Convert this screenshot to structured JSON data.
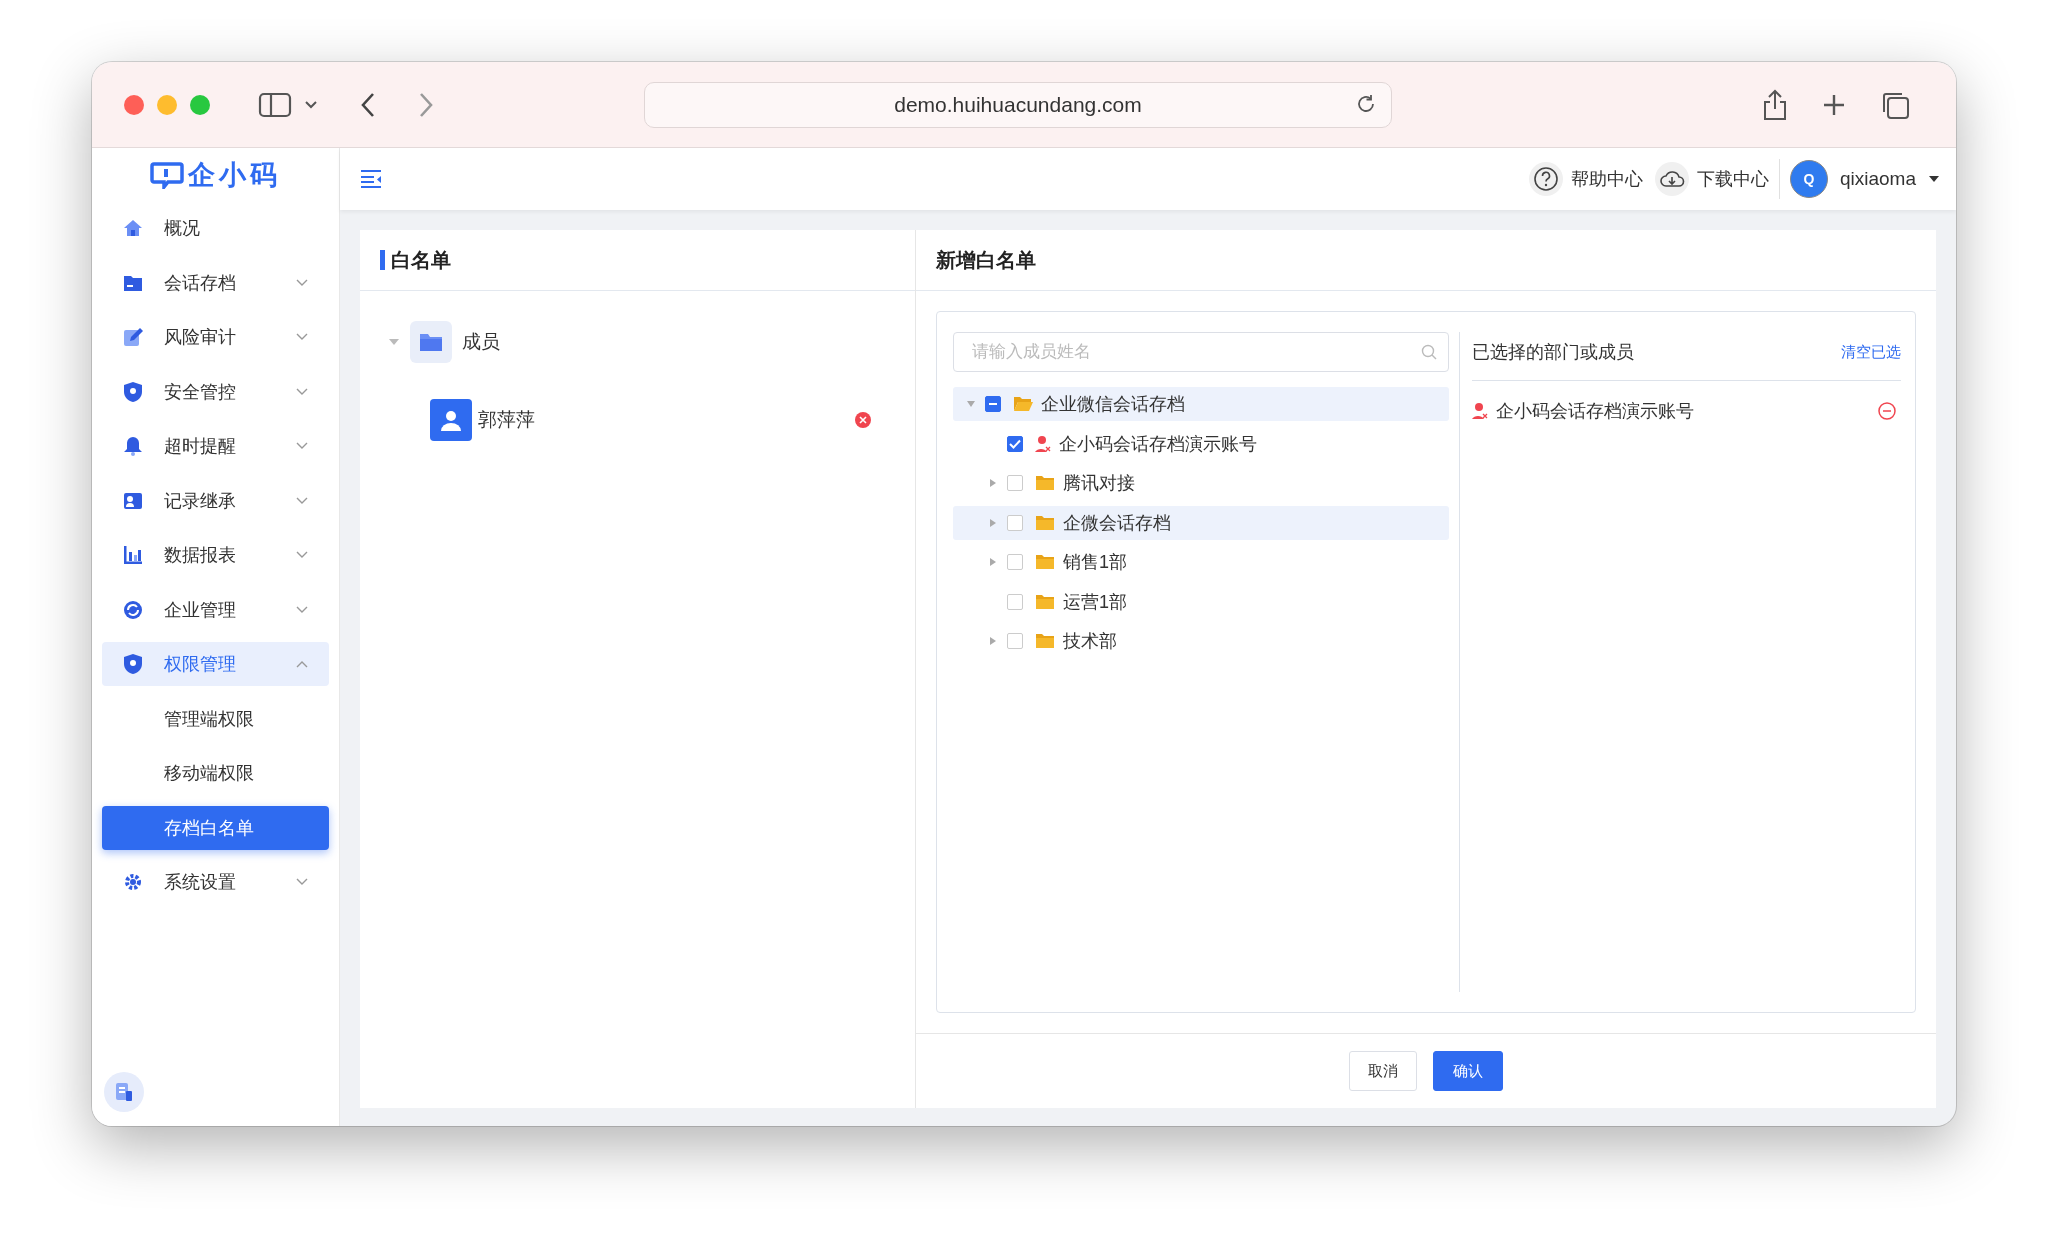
{
  "browser": {
    "url": "demo.huihuacundang.com"
  },
  "sidebar": {
    "logo": "企小码",
    "items": [
      {
        "label": "概况",
        "kind": "link"
      },
      {
        "label": "会话存档",
        "kind": "group",
        "expanded": false
      },
      {
        "label": "风险审计",
        "kind": "group",
        "expanded": false
      },
      {
        "label": "安全管控",
        "kind": "group",
        "expanded": false
      },
      {
        "label": "超时提醒",
        "kind": "group",
        "expanded": false
      },
      {
        "label": "记录继承",
        "kind": "group",
        "expanded": false
      },
      {
        "label": "数据报表",
        "kind": "group",
        "expanded": false
      },
      {
        "label": "企业管理",
        "kind": "group",
        "expanded": false
      },
      {
        "label": "权限管理",
        "kind": "group",
        "expanded": true,
        "children": [
          {
            "label": "管理端权限",
            "selected": false
          },
          {
            "label": "移动端权限",
            "selected": false
          },
          {
            "label": "存档白名单",
            "selected": true
          }
        ]
      },
      {
        "label": "系统设置",
        "kind": "group",
        "expanded": false
      }
    ]
  },
  "header": {
    "help": "帮助中心",
    "download": "下载中心",
    "user": {
      "initial": "Q",
      "name": "qixiaoma"
    }
  },
  "whitelist": {
    "title": "白名单",
    "tree": [
      {
        "label": "成员",
        "expanded": true,
        "children": [
          {
            "label": "郭萍萍"
          }
        ]
      }
    ]
  },
  "add": {
    "title": "新增白名单",
    "search": {
      "placeholder": "请输入成员姓名"
    },
    "tree": [
      {
        "label": "企业微信会话存档",
        "kind": "folder",
        "has_children": true,
        "expanded": true,
        "checked": false,
        "indeterminate": true,
        "selected": true,
        "children": [
          {
            "label": "企小码会话存档演示账号",
            "kind": "member",
            "checked": true,
            "indeterminate": false,
            "selected": false
          },
          {
            "label": "腾讯对接",
            "kind": "folder",
            "has_children": true,
            "expanded": false,
            "checked": false,
            "indeterminate": false,
            "selected": false
          },
          {
            "label": "企微会话存档",
            "kind": "folder",
            "has_children": true,
            "expanded": false,
            "checked": false,
            "indeterminate": false,
            "selected": true
          },
          {
            "label": "销售1部",
            "kind": "folder",
            "has_children": true,
            "expanded": false,
            "checked": false,
            "indeterminate": false,
            "selected": false
          },
          {
            "label": "运营1部",
            "kind": "folder",
            "has_children": false,
            "expanded": false,
            "checked": false,
            "indeterminate": false,
            "selected": false
          },
          {
            "label": "技术部",
            "kind": "folder",
            "has_children": true,
            "expanded": false,
            "checked": false,
            "indeterminate": false,
            "selected": false
          }
        ]
      }
    ],
    "selected_title": "已选择的部门或成员",
    "clear": "清空已选",
    "selected_items": [
      {
        "label": "企小码会话存档演示账号",
        "kind": "member"
      }
    ],
    "buttons": [
      {
        "label": "取消",
        "kind": "secondary"
      },
      {
        "label": "确认",
        "kind": "primary"
      }
    ]
  }
}
